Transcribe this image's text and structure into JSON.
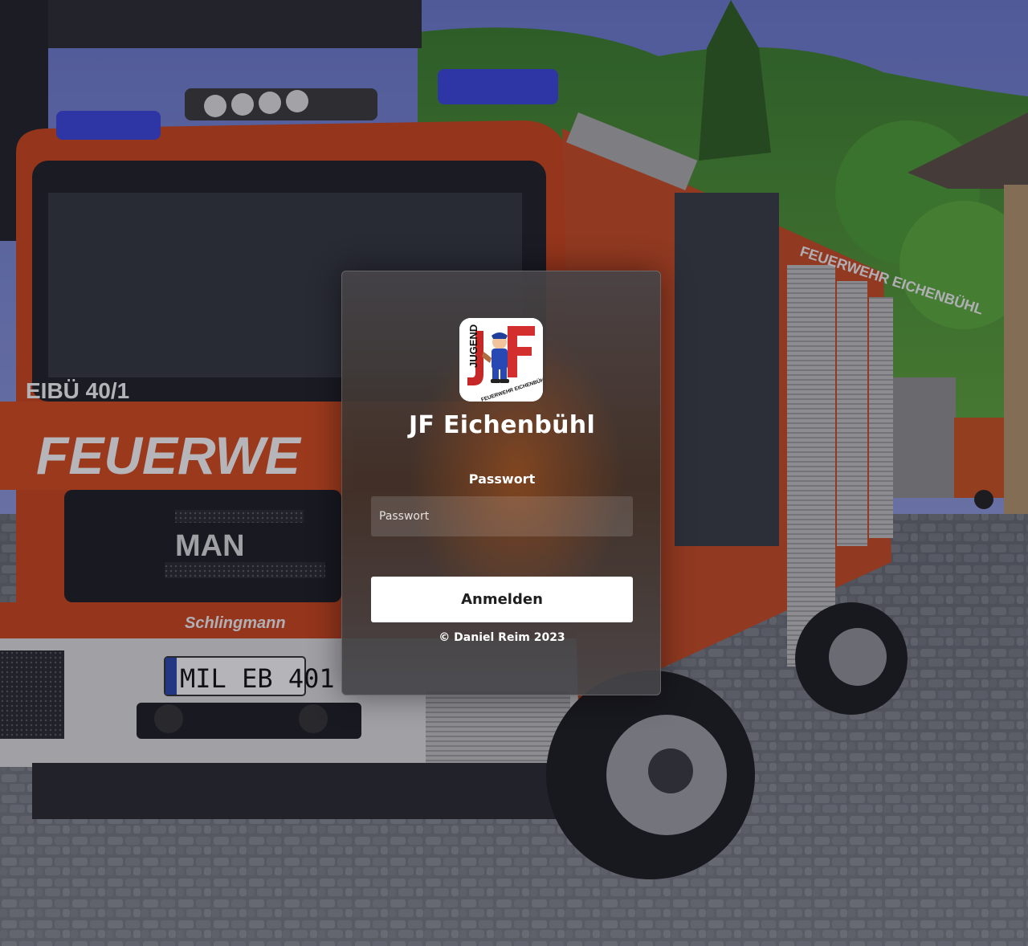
{
  "background": {
    "photo_subject": "fire-truck-photo",
    "vehicle_callsign": "EIBÜ 40/1",
    "grille_lettering": "FEUERWE",
    "brand_badge": "MAN",
    "bodybuilder": "Schlingmann",
    "license_plate": "MIL EB 401",
    "side_lettering": "FEUERWEHR EICHENBÜHL"
  },
  "login": {
    "logo_icon": "jugendfeuerwehr-logo-icon",
    "logo_text": {
      "word": "JUGEND",
      "letter": "F",
      "ring": "FEUERWEHR EICHENBÜHL"
    },
    "title": "JF Eichenbühl",
    "password_label": "Passwort",
    "password_placeholder": "Passwort",
    "password_value": "",
    "submit_label": "Anmelden",
    "copyright": "© Daniel Reim 2023"
  },
  "colors": {
    "truck_red": "#c8441b",
    "card_glow": "#b4551a",
    "button_bg": "#ffffff",
    "text": "#ffffff"
  }
}
